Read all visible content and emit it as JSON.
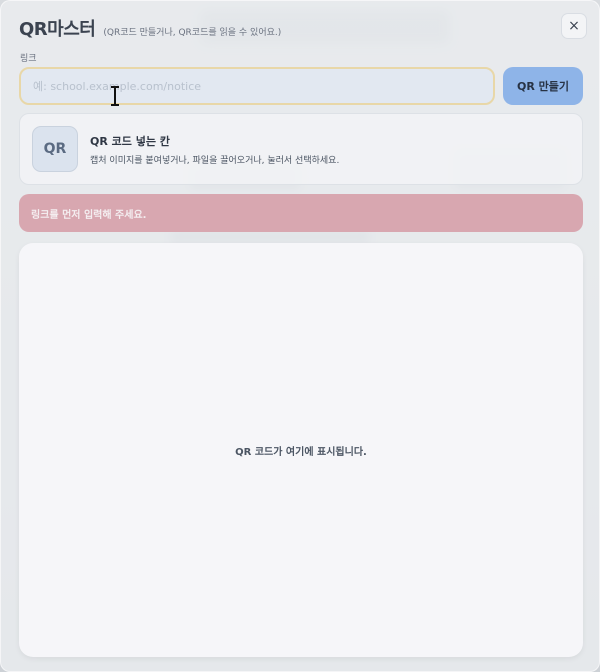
{
  "app": {
    "title": "QR마스터",
    "subtitle": "(QR코드 만들거나, QR코드를 읽을 수 있어요.)",
    "close_label": "×"
  },
  "link_field": {
    "label": "링크",
    "value": "",
    "placeholder": "예: school.example.com/notice"
  },
  "make_button": {
    "label": "QR 만들기"
  },
  "drop_zone": {
    "badge": "QR",
    "title": "QR 코드 넣는 칸",
    "description": "캡처 이미지를 붙여넣거나, 파일을 끌어오거나, 눌러서 선택하세요."
  },
  "error": {
    "message": "링크를 먼저 입력해 주세요."
  },
  "preview": {
    "placeholder": "QR 코드가 여기에 표시됩니다."
  },
  "colors": {
    "primary_button": "#8eb4e8",
    "error_banner": "#d8a7b0",
    "input_border": "#e8d7a8"
  }
}
